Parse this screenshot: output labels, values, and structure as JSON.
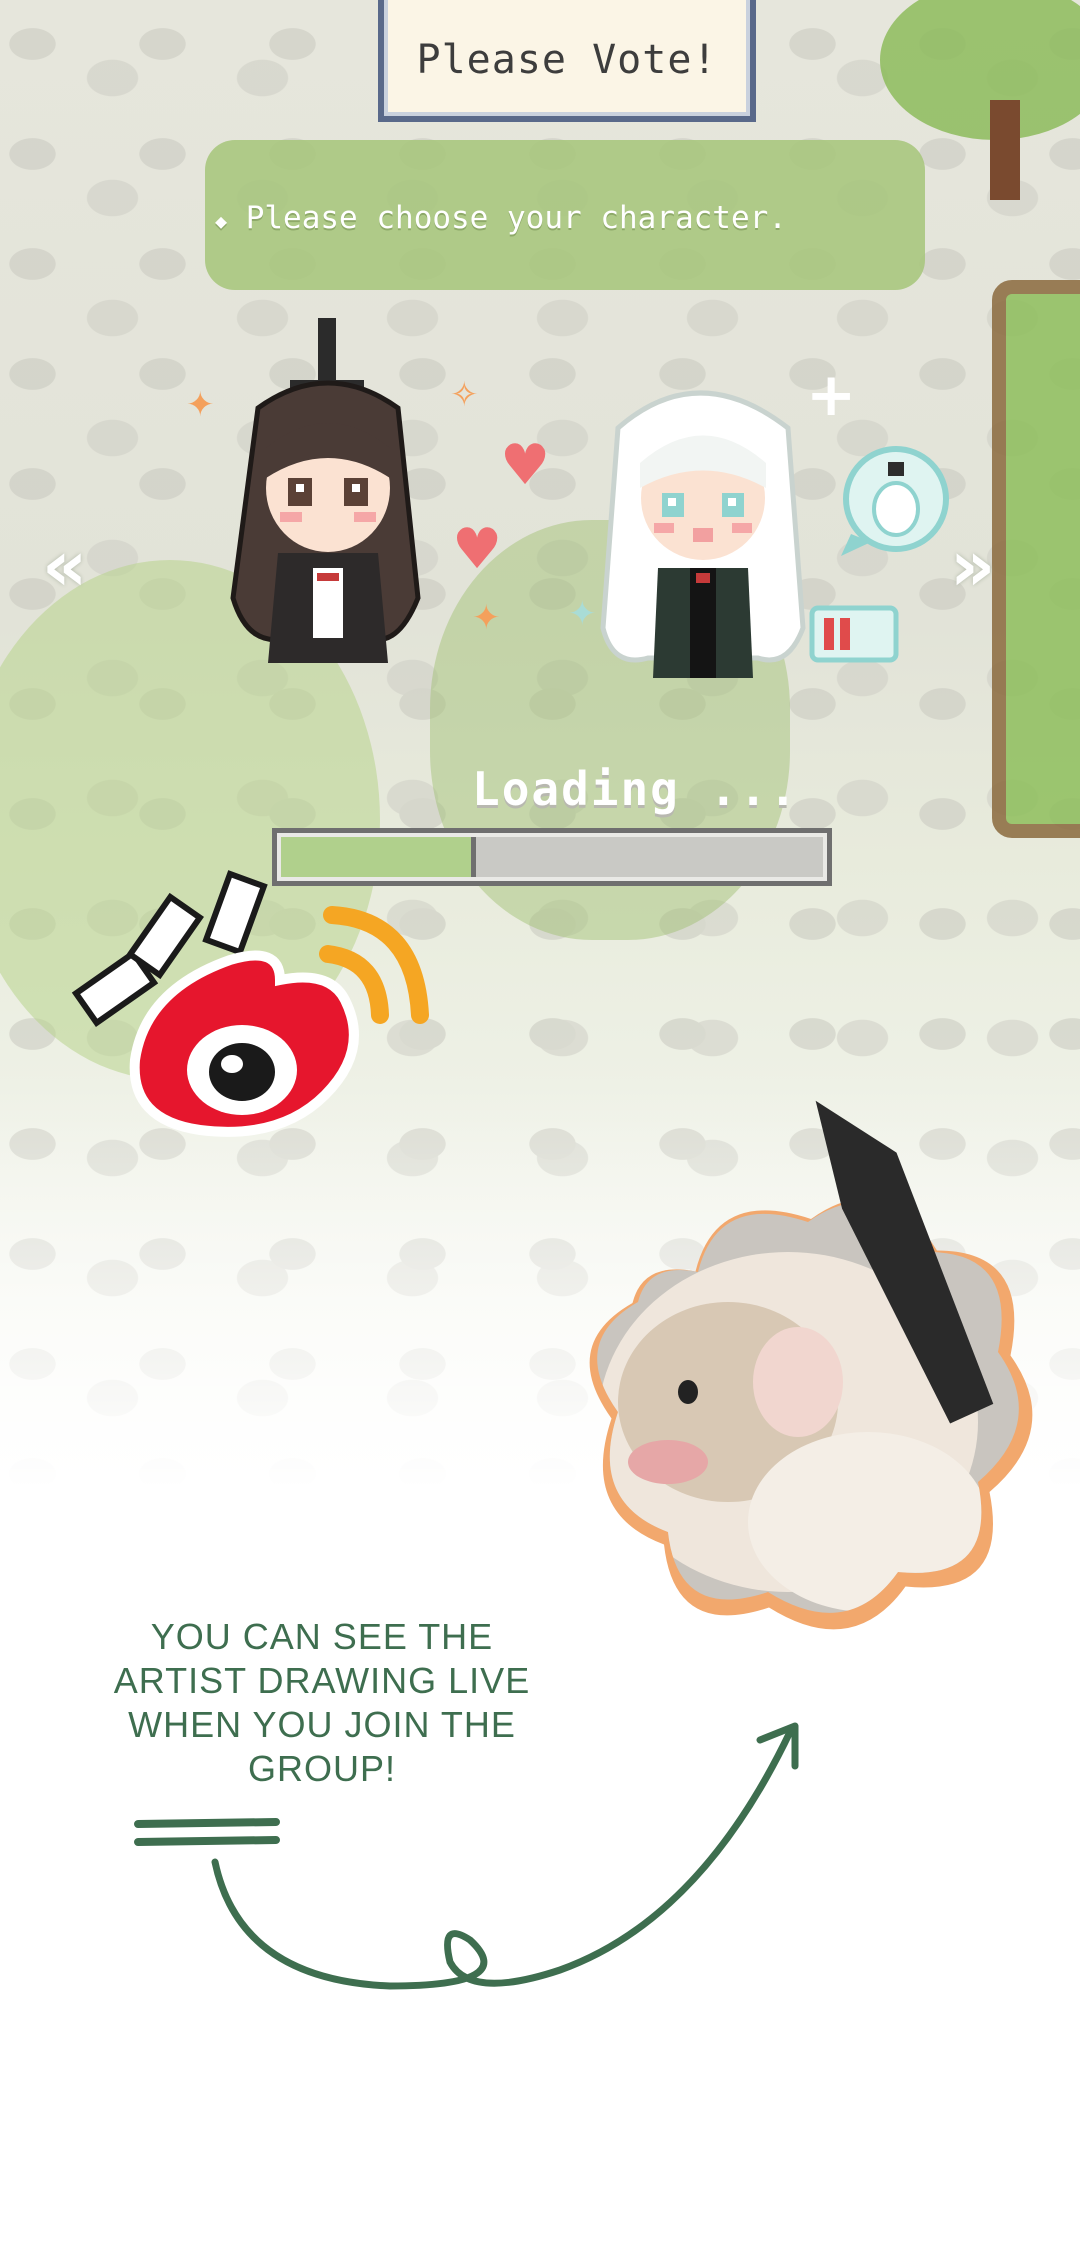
{
  "game": {
    "vote_button": "Please Vote!",
    "prompt": "Please choose your character.",
    "nav_prev": "«",
    "nav_next": "»",
    "loading_label": "Loading ...",
    "progress": 0.36
  },
  "characters": [
    {
      "id": "dark-hair"
    },
    {
      "id": "white-hair"
    }
  ],
  "promo": {
    "text": "YOU CAN SEE THE ARTIST DRAWING LIVE WHEN YOU JOIN THE GROUP!",
    "logo": "weibo-logo",
    "photo": "hamster-photo"
  },
  "colors": {
    "text_green": "#3e6e4f",
    "progress_fill": "#b0d08c",
    "weibo_red": "#e6162d",
    "weibo_orange": "#f5a623",
    "frame_orange": "#f2a86d"
  }
}
